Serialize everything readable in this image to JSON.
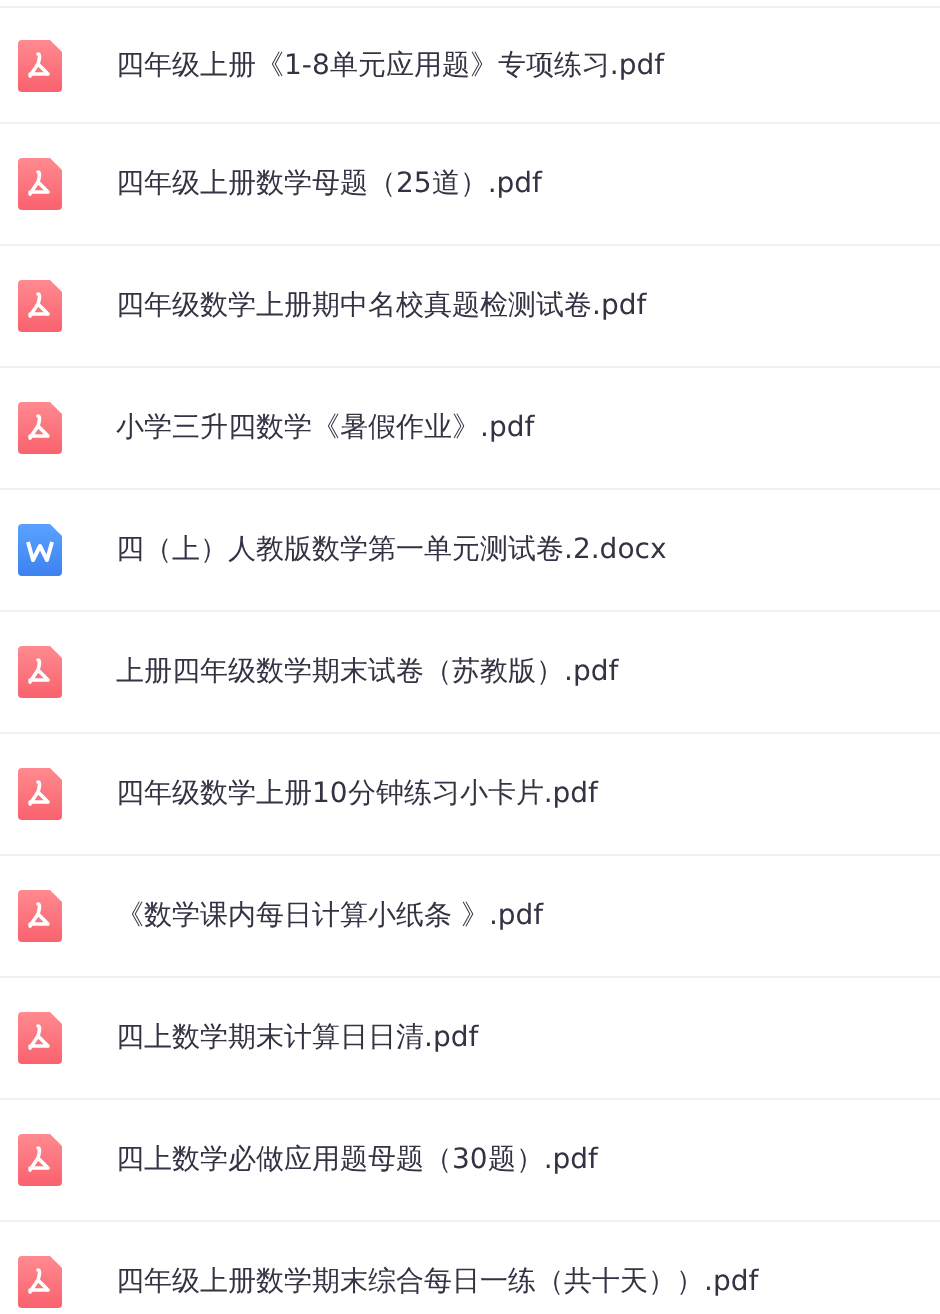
{
  "files": [
    {
      "kind": "pdf",
      "name": "四年级上册《1-8单元应用题》专项练习.pdf"
    },
    {
      "kind": "pdf",
      "name": "四年级上册数学母题（25道）.pdf"
    },
    {
      "kind": "pdf",
      "name": "四年级数学上册期中名校真题检测试卷.pdf"
    },
    {
      "kind": "pdf",
      "name": "小学三升四数学《暑假作业》.pdf"
    },
    {
      "kind": "word",
      "name": "四（上）人教版数学第一单元测试卷.2.docx"
    },
    {
      "kind": "pdf",
      "name": "上册四年级数学期末试卷（苏教版）.pdf"
    },
    {
      "kind": "pdf",
      "name": "四年级数学上册10分钟练习小卡片.pdf"
    },
    {
      "kind": "pdf",
      "name": "《数学课内每日计算小纸条 》.pdf"
    },
    {
      "kind": "pdf",
      "name": "四上数学期末计算日日清.pdf"
    },
    {
      "kind": "pdf",
      "name": "四上数学必做应用题母题（30题）.pdf"
    },
    {
      "kind": "pdf",
      "name": "四年级上册数学期末综合每日一练（共十天））.pdf"
    }
  ]
}
